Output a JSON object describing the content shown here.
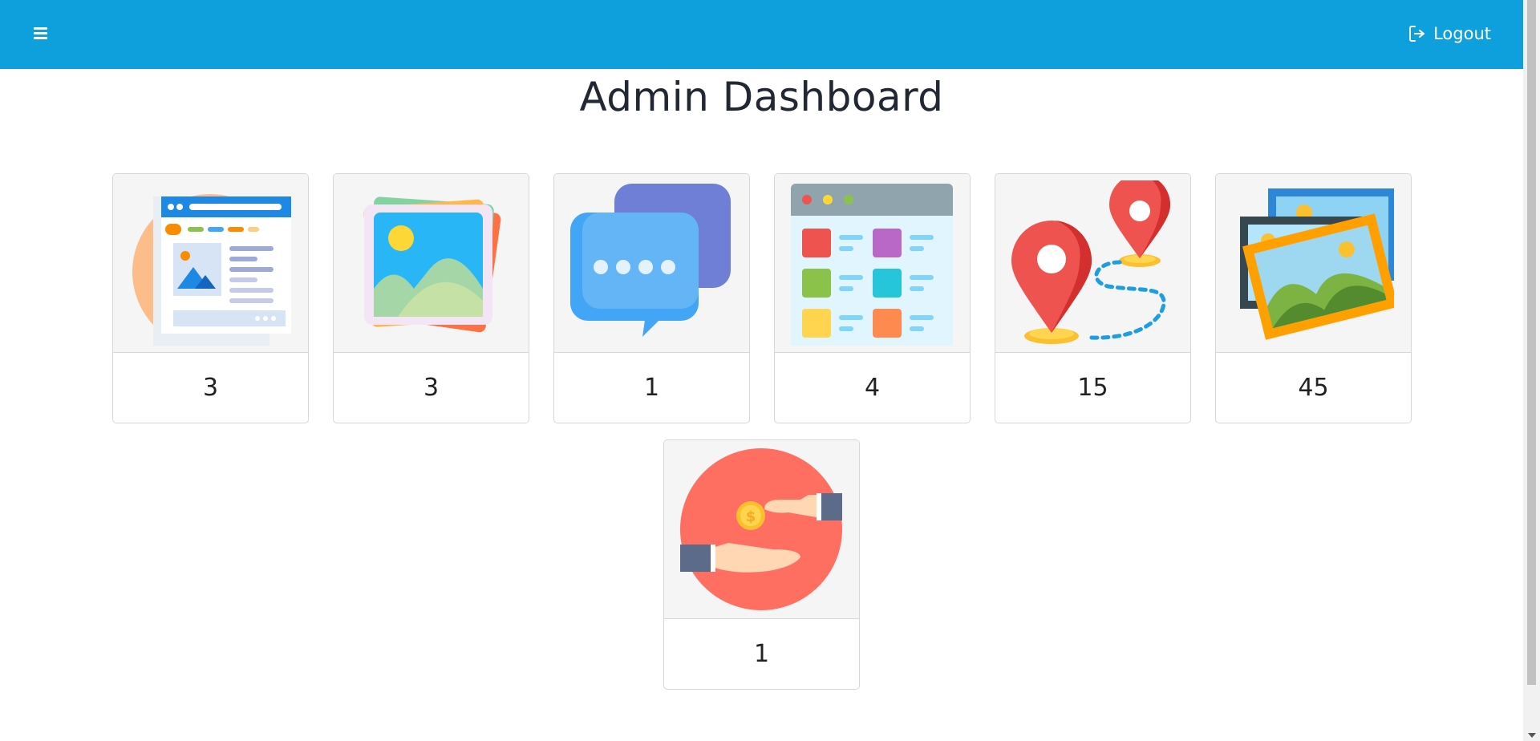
{
  "header": {
    "menu_icon": "hamburger-menu-icon",
    "logout_label": "Logout",
    "logout_icon": "logout-icon",
    "bar_color": "#0da0dc"
  },
  "page": {
    "title": "Admin Dashboard"
  },
  "cards": [
    {
      "icon": "web-page-icon",
      "count": "3"
    },
    {
      "icon": "image-gallery-icon",
      "count": "3"
    },
    {
      "icon": "chat-bubbles-icon",
      "count": "1"
    },
    {
      "icon": "app-grid-window-icon",
      "count": "4"
    },
    {
      "icon": "map-route-pins-icon",
      "count": "15"
    },
    {
      "icon": "framed-pictures-icon",
      "count": "45"
    },
    {
      "icon": "coin-payment-hands-icon",
      "count": "1"
    }
  ]
}
